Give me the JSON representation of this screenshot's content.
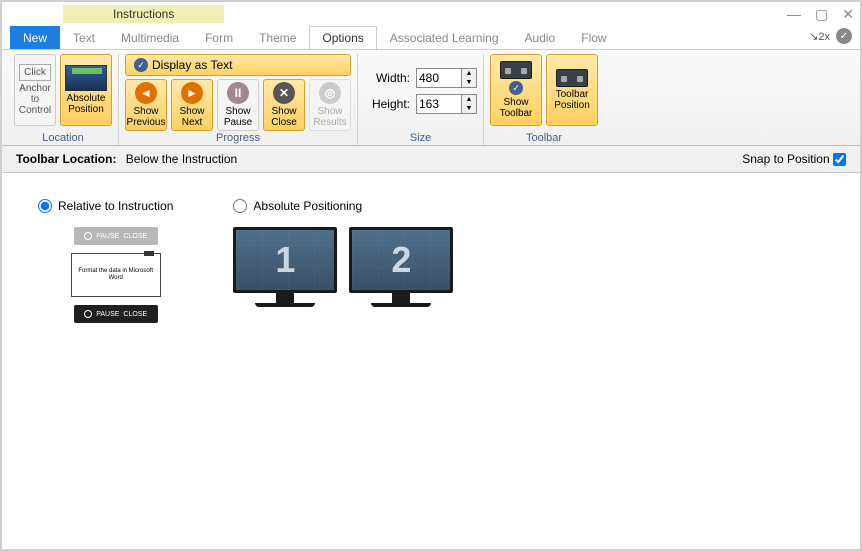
{
  "window": {
    "title": "Instructions",
    "zoom": "2x"
  },
  "tabs": {
    "new": "New",
    "text": "Text",
    "multimedia": "Multimedia",
    "form": "Form",
    "theme": "Theme",
    "options": "Options",
    "assoc": "Associated Learning",
    "audio": "Audio",
    "flow": "Flow"
  },
  "ribbon": {
    "location": {
      "anchor_click": "Click",
      "anchor_label": "Anchor to Control",
      "absolute": "Absolute Position",
      "group_label": "Location"
    },
    "progress": {
      "display_text": "Display as Text",
      "prev": "Show Previous",
      "next": "Show Next",
      "pause": "Show Pause",
      "close": "Show Close",
      "results": "Show Results",
      "group_label": "Progress"
    },
    "size": {
      "width_label": "Width:",
      "width_value": "480",
      "height_label": "Height:",
      "height_value": "163",
      "group_label": "Size"
    },
    "toolbar": {
      "show": "Show Toolbar",
      "position": "Toolbar Position",
      "group_label": "Toolbar"
    }
  },
  "infobar": {
    "label": "Toolbar Location:",
    "value": "Below the Instruction",
    "snap_label": "Snap to Position"
  },
  "content": {
    "relative_label": "Relative to Instruction",
    "absolute_label": "Absolute Positioning",
    "card_text": "Format the data in Microsoft Word",
    "pause": "PAUSE",
    "close": "CLOSE",
    "m1": "1",
    "m2": "2"
  }
}
